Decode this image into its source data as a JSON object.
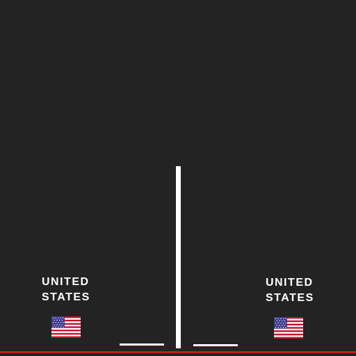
{
  "game": {
    "background_color": "#232323",
    "ground_color": "#c0201a",
    "left_player": {
      "country": "UNITED\nSTATES",
      "flag_icon": "us-flag-icon"
    },
    "right_player": {
      "country": "UNITED\nSTATES",
      "flag_icon": "us-flag-icon"
    },
    "net_color": "#ffffff"
  }
}
